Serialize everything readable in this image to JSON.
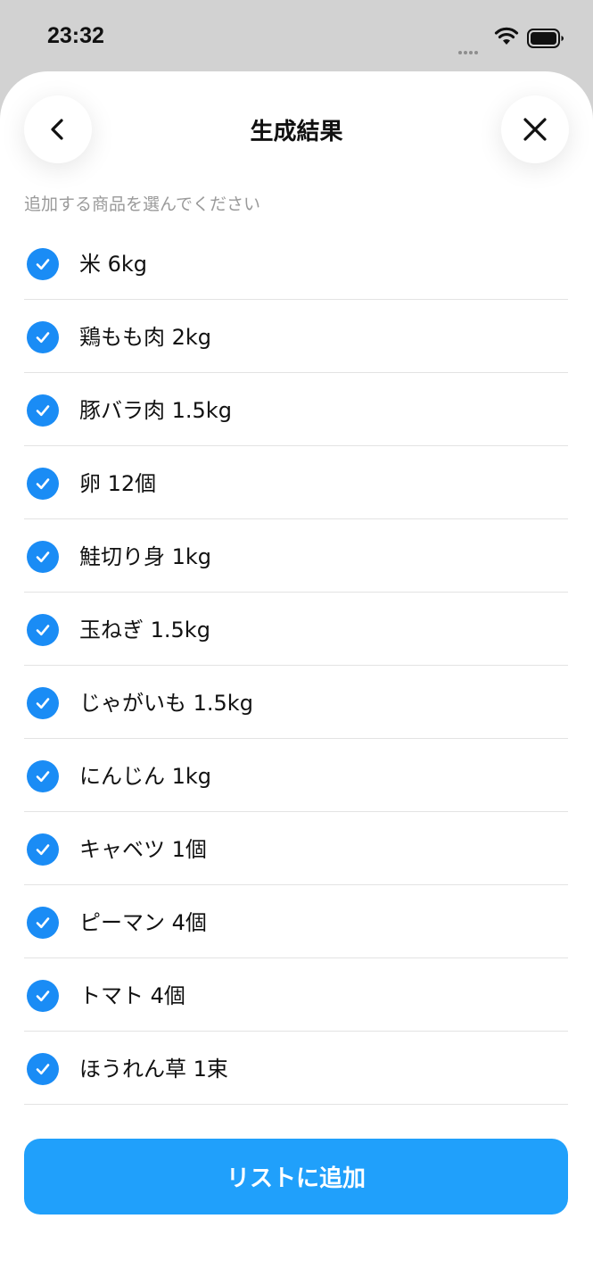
{
  "status_bar": {
    "time": "23:32"
  },
  "header": {
    "title": "生成結果",
    "back_icon": "chevron-left-icon",
    "close_icon": "close-icon"
  },
  "instruction": "追加する商品を選んでください",
  "items": [
    {
      "label": "米 6kg",
      "checked": true
    },
    {
      "label": "鶏もも肉 2kg",
      "checked": true
    },
    {
      "label": "豚バラ肉 1.5kg",
      "checked": true
    },
    {
      "label": "卵 12個",
      "checked": true
    },
    {
      "label": "鮭切り身 1kg",
      "checked": true
    },
    {
      "label": "玉ねぎ 1.5kg",
      "checked": true
    },
    {
      "label": "じゃがいも 1.5kg",
      "checked": true
    },
    {
      "label": "にんじん 1kg",
      "checked": true
    },
    {
      "label": "キャベツ 1個",
      "checked": true
    },
    {
      "label": "ピーマン 4個",
      "checked": true
    },
    {
      "label": "トマト 4個",
      "checked": true
    },
    {
      "label": "ほうれん草 1束",
      "checked": true
    }
  ],
  "add_button_label": "リストに追加",
  "colors": {
    "accent": "#20a0fb",
    "check": "#1a8cf5",
    "backdrop": "#d2d2d2"
  }
}
